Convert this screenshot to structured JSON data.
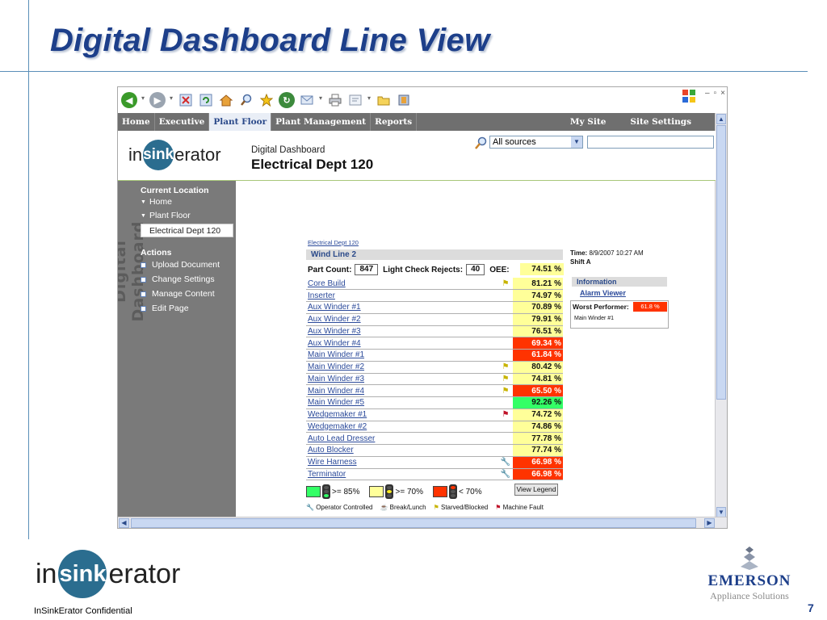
{
  "slide": {
    "title": "Digital Dashboard Line View",
    "footer": "InSinkErator Confidential",
    "page_number": "7",
    "logo": {
      "pre": "in",
      "mid": "sink",
      "post": "erator"
    },
    "emerson": {
      "name": "EMERSON",
      "sub": "Appliance Solutions"
    }
  },
  "browser": {
    "nav": {
      "items": [
        "Home",
        "Executive",
        "Plant Floor",
        "Plant Management",
        "Reports"
      ],
      "active": "Plant Floor",
      "right_items": [
        "My Site",
        "Site Settings"
      ]
    },
    "header": {
      "site_subtitle": "Digital Dashboard",
      "site_title": "Electrical Dept 120",
      "search_scope": "All sources",
      "search_value": ""
    },
    "sidebar": {
      "vertical_word": "Digital Dashboard",
      "current_location_label": "Current Location",
      "locations": [
        "Home",
        "Plant Floor"
      ],
      "selected": "Electrical Dept 120",
      "actions_label": "Actions",
      "actions": [
        "Upload Document",
        "Change Settings",
        "Manage Content",
        "Edit Page"
      ]
    },
    "content": {
      "breadcrumb": "Electrical Dept 120",
      "line_title": "Wind Line 2",
      "part_count_label": "Part Count:",
      "part_count": "847",
      "rejects_label": "Light Check Rejects:",
      "rejects": "40",
      "oee_label": "OEE:",
      "oee": "74.51 %",
      "rows": [
        {
          "name": "Core Build",
          "value": "81.21 %",
          "status": "yellow",
          "icon": "starved-blocked"
        },
        {
          "name": "Inserter",
          "value": "74.97 %",
          "status": "yellow",
          "icon": ""
        },
        {
          "name": "Aux Winder #1",
          "value": "70.89 %",
          "status": "yellow",
          "icon": ""
        },
        {
          "name": "Aux Winder #2",
          "value": "79.91 %",
          "status": "yellow",
          "icon": ""
        },
        {
          "name": "Aux Winder #3",
          "value": "76.51 %",
          "status": "yellow",
          "icon": ""
        },
        {
          "name": "Aux Winder #4",
          "value": "69.34 %",
          "status": "red",
          "icon": ""
        },
        {
          "name": "Main Winder #1",
          "value": "61.84 %",
          "status": "red",
          "icon": ""
        },
        {
          "name": "Main Winder #2",
          "value": "80.42 %",
          "status": "yellow",
          "icon": "starved-blocked"
        },
        {
          "name": "Main Winder #3",
          "value": "74.81 %",
          "status": "yellow",
          "icon": "starved-blocked"
        },
        {
          "name": "Main Winder #4",
          "value": "65.50 %",
          "status": "red",
          "icon": "starved-blocked"
        },
        {
          "name": "Main Winder #5",
          "value": "92.26 %",
          "status": "green",
          "icon": ""
        },
        {
          "name": "Wedgemaker #1",
          "value": "74.72 %",
          "status": "yellow",
          "icon": "machine-fault"
        },
        {
          "name": "Wedgemaker #2",
          "value": "74.86 %",
          "status": "yellow",
          "icon": ""
        },
        {
          "name": "Auto Lead Dresser",
          "value": "77.78 %",
          "status": "yellow",
          "icon": ""
        },
        {
          "name": "Auto Blocker",
          "value": "77.74 %",
          "status": "yellow",
          "icon": ""
        },
        {
          "name": "Wire Harness",
          "value": "66.98 %",
          "status": "red",
          "icon": "operator-controlled"
        },
        {
          "name": "Terminator",
          "value": "66.98 %",
          "status": "red",
          "icon": "operator-controlled"
        }
      ],
      "legend": {
        "green": ">= 85%",
        "yellow": ">= 70%",
        "red": "< 70%",
        "view_legend": "View Legend",
        "operator": "Operator Controlled",
        "break": "Break/Lunch",
        "starved": "Starved/Blocked",
        "fault": "Machine Fault"
      },
      "time_label": "Time:",
      "time_value": "8/9/2007 10:27 AM",
      "shift": "Shift A",
      "info_title": "Information",
      "alarm_viewer": "Alarm Viewer",
      "worst_label": "Worst Performer:",
      "worst_value": "61.8 %",
      "worst_name": "Main Winder #1"
    }
  },
  "colors": {
    "green": "#33ff66",
    "yellow": "#ffff99",
    "red": "#ff3300",
    "title": "#1d3f8a",
    "nav": "#6f6f6f",
    "sidebar": "#7a7a7a"
  }
}
